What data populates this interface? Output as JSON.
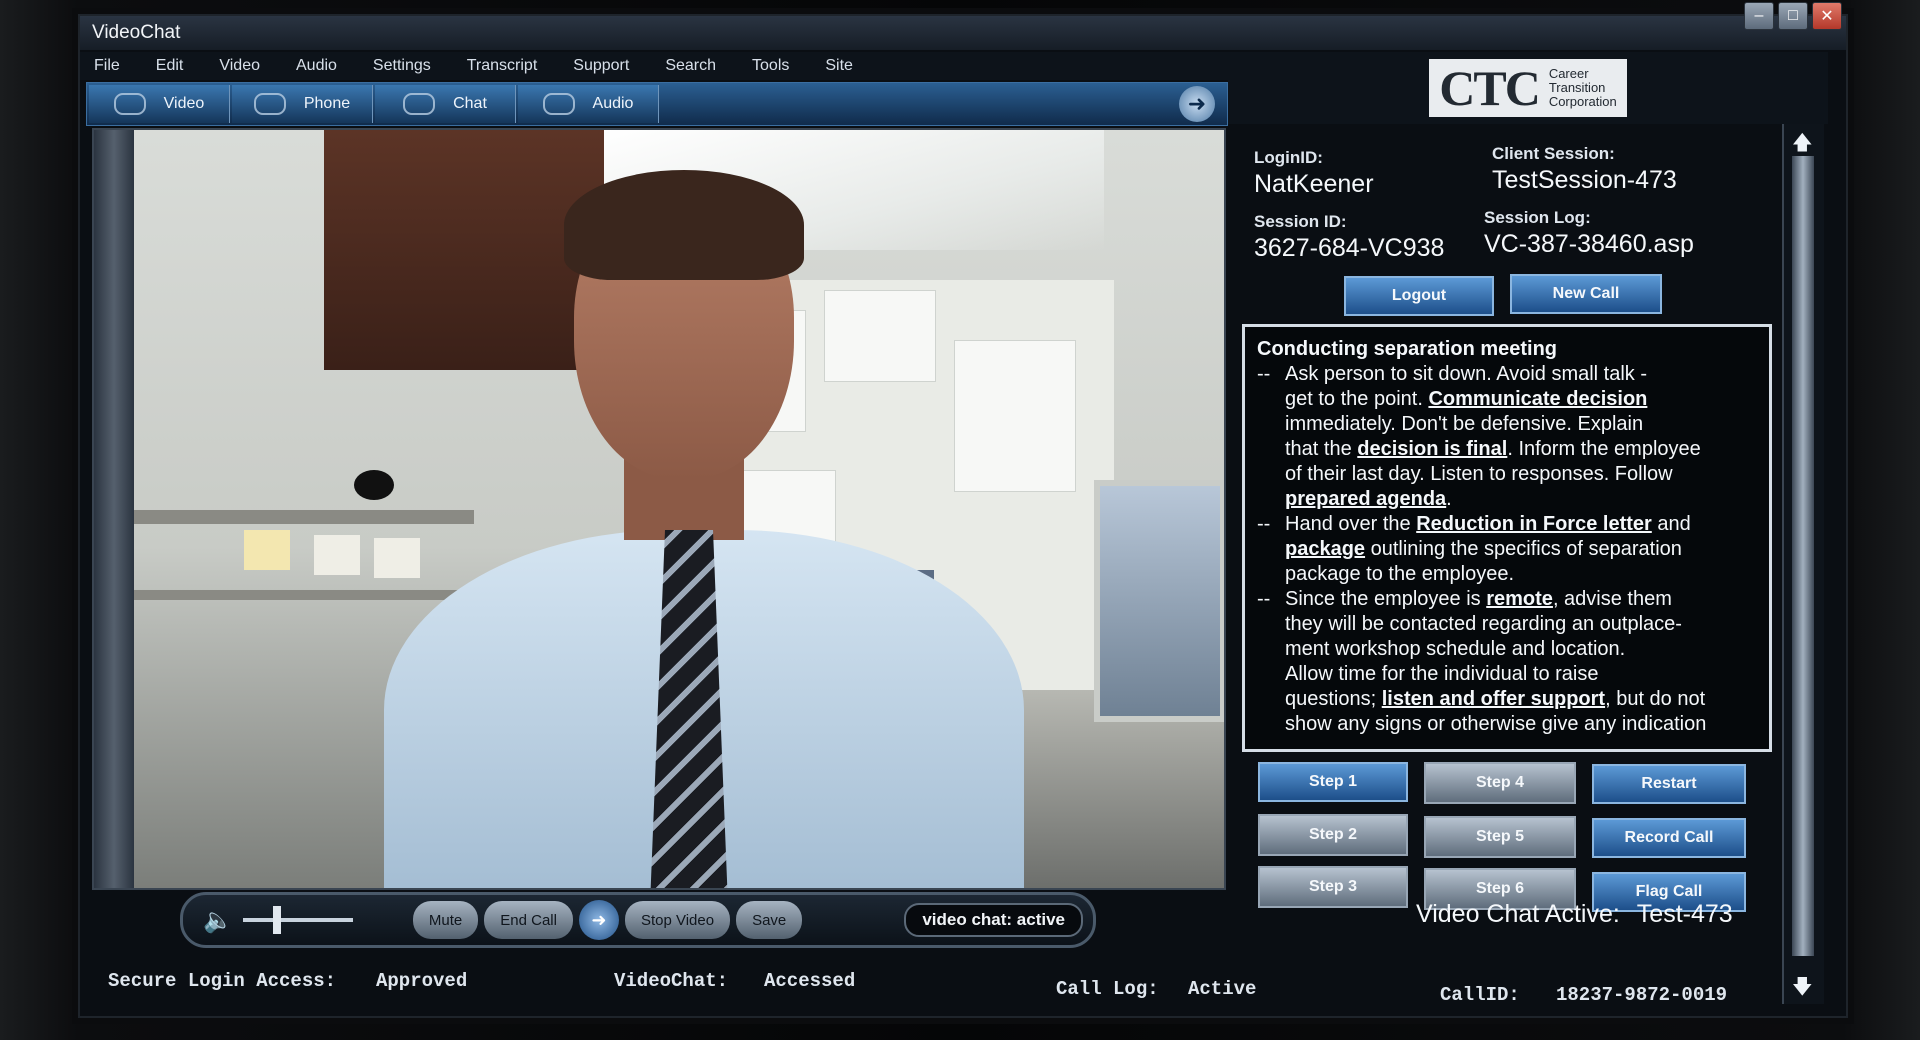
{
  "window": {
    "title": "VideoChat",
    "minimize": "–",
    "maximize": "□",
    "close": "✕"
  },
  "menu": [
    "File",
    "Edit",
    "Video",
    "Audio",
    "Settings",
    "Transcript",
    "Support",
    "Search",
    "Tools",
    "Site"
  ],
  "toolbar": {
    "video": "Video",
    "phone": "Phone",
    "chat": "Chat",
    "audio": "Audio",
    "next_arrow": "➜"
  },
  "logo": {
    "mark": "CTC",
    "line1": "Career",
    "line2": "Transition",
    "line3": "Corporation"
  },
  "session": {
    "login_label": "LoginID:",
    "login_value": "NatKeener",
    "client_label": "Client Session:",
    "client_value": "TestSession-473",
    "session_id_label": "Session ID:",
    "session_id_value": "3627-684-VC938",
    "session_log_label": "Session Log:",
    "session_log_value": "VC-387-38460.asp"
  },
  "buttons": {
    "logout": "Logout",
    "new_call": "New Call"
  },
  "script": {
    "title": "Conducting separation meeting",
    "bullet1_a": "Ask person to sit down.  Avoid small talk -",
    "bullet1_b": "get to the point. ",
    "bullet1_link1": "Communicate decision",
    "bullet1_c": "immediately.  Don't be defensive.  Explain",
    "bullet1_d": "that the ",
    "bullet1_link2": "decision is final",
    "bullet1_e": ".  Inform the employee",
    "bullet1_f": "of their last day.  Listen to responses.  Follow",
    "bullet1_link3": "prepared agenda",
    "bullet1_g": ".",
    "bullet2_a": "Hand over the ",
    "bullet2_link1": "Reduction in Force letter",
    "bullet2_b": " and",
    "bullet2_link2": "package",
    "bullet2_c": " outlining the specifics of separation",
    "bullet2_d": "package to the employee.",
    "bullet3_a": "Since the employee is ",
    "bullet3_link1": "remote",
    "bullet3_b": ", advise them",
    "bullet3_c": "they will be contacted regarding an outplace-",
    "bullet3_d": "ment workshop schedule and location.",
    "bullet3_e": "Allow time for the individual to raise",
    "bullet3_f": "questions; ",
    "bullet3_link2": "listen and offer support",
    "bullet3_g": ", but do not",
    "bullet3_h": "show any signs or otherwise give any indication",
    "dash": "--"
  },
  "steps": [
    "Step 1",
    "Step 4",
    "Restart",
    "Step 2",
    "Step 5",
    "Record Call",
    "Step 3",
    "Step 6",
    "Flag Call"
  ],
  "chat_active": {
    "label": "Video Chat Active:",
    "value": "Test-473"
  },
  "controls": {
    "volume_icon": "🔈",
    "mute": "Mute",
    "end_call": "End Call",
    "play_icon": "➜",
    "stop_video": "Stop Video",
    "save": "Save",
    "status": "video chat: active"
  },
  "footer": {
    "secure_label": "Secure Login Access:",
    "secure_value": "Approved",
    "videochat_label": "VideoChat:",
    "videochat_value": "Accessed",
    "calllog_label": "Call Log:",
    "calllog_value": "Active",
    "callid_label": "CallID:",
    "callid_value": "18237-9872-0019"
  },
  "scroll": {
    "up": "🡅",
    "down": "🡇"
  },
  "colors": {
    "accent_blue": "#2b5f92",
    "button_gray": "#8a97a5",
    "background": "#0a0e13"
  }
}
